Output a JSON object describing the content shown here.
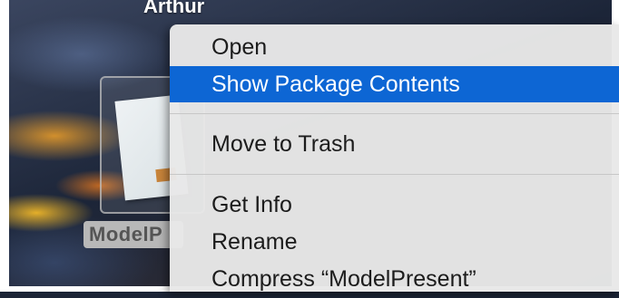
{
  "desktop": {
    "user_label": "Arthur",
    "file": {
      "name_visible": "ModelP"
    }
  },
  "context_menu": {
    "items": [
      {
        "label": "Open"
      },
      {
        "label": "Show Package Contents",
        "highlighted": true
      },
      {
        "label": "Move to Trash"
      },
      {
        "label": "Get Info"
      },
      {
        "label": "Rename"
      },
      {
        "label": "Compress “ModelPresent”"
      }
    ],
    "highlight_color": "#0d66d4"
  }
}
